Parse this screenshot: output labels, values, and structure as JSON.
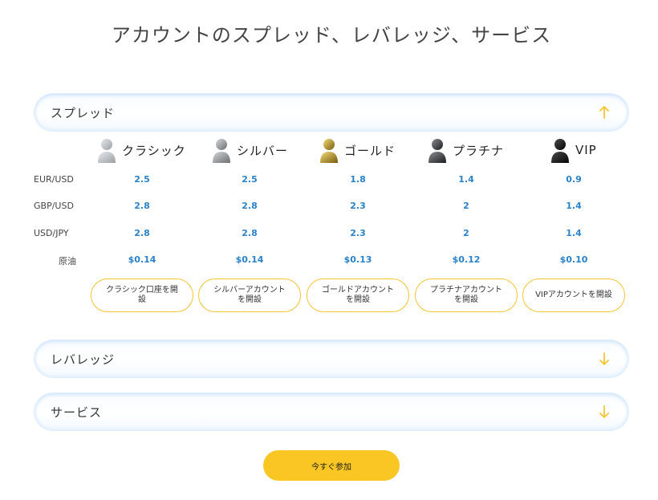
{
  "page": {
    "title": "アカウントのスプレッド、レバレッジ、サービス"
  },
  "sections": {
    "spread": {
      "label": "スプレッド",
      "state": "expanded"
    },
    "leverage": {
      "label": "レバレッジ",
      "state": "collapsed"
    },
    "service": {
      "label": "サービス",
      "state": "collapsed"
    }
  },
  "tiers": [
    {
      "name": "クラシック",
      "icon": "person-silver-icon",
      "color": "#b9bcc0"
    },
    {
      "name": "シルバー",
      "icon": "person-silver-dark-icon",
      "color": "#8f9296"
    },
    {
      "name": "ゴールド",
      "icon": "person-gold-icon",
      "color": "#b8911f"
    },
    {
      "name": "プラチナ",
      "icon": "person-platinum-icon",
      "color": "#2e3033"
    },
    {
      "name": "VIP",
      "icon": "person-vip-icon",
      "color": "#111111"
    }
  ],
  "rows": [
    {
      "label": "EUR/USD",
      "values": [
        "2.5",
        "2.5",
        "1.8",
        "1.4",
        "0.9"
      ]
    },
    {
      "label": "GBP/USD",
      "values": [
        "2.8",
        "2.8",
        "2.3",
        "2",
        "1.4"
      ]
    },
    {
      "label": "USD/JPY",
      "values": [
        "2.8",
        "2.8",
        "2.3",
        "2",
        "1.4"
      ]
    },
    {
      "label": "原油",
      "values": [
        "$0.14",
        "$0.14",
        "$0.13",
        "$0.12",
        "$0.10"
      ]
    }
  ],
  "buttons": {
    "open_classic": "クラシック口座を開設",
    "open_silver": "シルバーアカウントを開設",
    "open_gold": "ゴールドアカウントを開設",
    "open_platinum": "プラチナアカウントを開設",
    "open_vip": "VIPアカウントを開設",
    "join_now": "今すぐ参加"
  },
  "colors": {
    "accent": "#f9c623",
    "value_blue": "#2b82c9",
    "arrow": "#f5c533"
  }
}
